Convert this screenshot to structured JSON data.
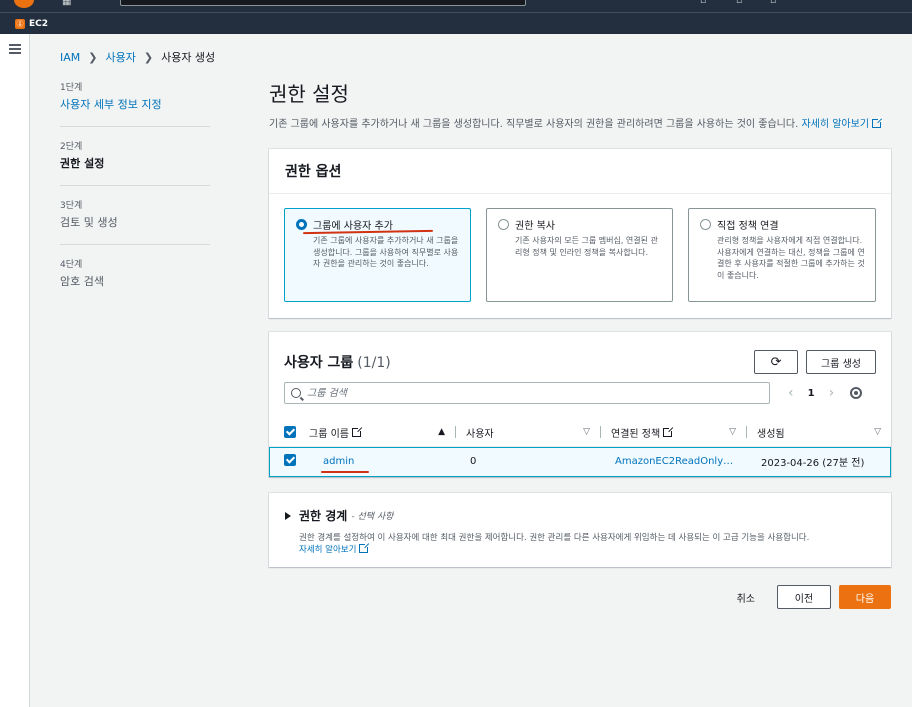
{
  "topnav": {
    "service_badge": "ⓖ",
    "service": "EC2"
  },
  "breadcrumb": {
    "items": [
      "IAM",
      "사용자",
      "사용자 생성"
    ]
  },
  "steps": [
    {
      "num": "1단계",
      "title": "사용자 세부 정보 지정"
    },
    {
      "num": "2단계",
      "title": "권한 설정"
    },
    {
      "num": "3단계",
      "title": "검토 및 생성"
    },
    {
      "num": "4단계",
      "title": "암호 검색"
    }
  ],
  "page": {
    "title": "권한 설정",
    "description": "기존 그룹에 사용자를 추가하거나 새 그룹을 생성합니다. 직무별로 사용자의 권한을 관리하려면 그룹을 사용하는 것이 좋습니다. ",
    "learn_more": "자세히 알아보기"
  },
  "options_panel": {
    "title": "권한 옵션",
    "options": [
      {
        "title": "그룹에 사용자 추가",
        "desc": "기존 그룹에 사용자를 추가하거나 새 그룹을 생성합니다. 그룹을 사용하여 직무별로 사용자 권한을 관리하는 것이 좋습니다.",
        "selected": true
      },
      {
        "title": "권한 복사",
        "desc": "기존 사용자의 모든 그룹 멤버십, 연결된 관리형 정책 및 인라인 정책을 복사합니다.",
        "selected": false
      },
      {
        "title": "직접 정책 연결",
        "desc": "관리형 정책을 사용자에게 직접 연결합니다. 사용자에게 연결하는 대신, 정책을 그룹에 연결한 후 사용자를 적절한 그룹에 추가하는 것이 좋습니다.",
        "selected": false
      }
    ]
  },
  "groups_panel": {
    "title": "사용자 그룹",
    "count": "(1/1)",
    "refresh_icon": "⟳",
    "create_button": "그룹 생성",
    "search_placeholder": "그룹 검색",
    "page": "1",
    "prev": "‹",
    "next": "›",
    "sort_asc_icon": "▲",
    "sort_icon": "▽",
    "columns": [
      "그룹 이름",
      "사용자",
      "연결된 정책",
      "생성됨"
    ],
    "rows": [
      {
        "name": "admin",
        "users": "0",
        "policy": "AmazonEC2ReadOnly…",
        "created": "2023-04-26 (27분 전)"
      }
    ]
  },
  "boundary_panel": {
    "title": "권한 경계",
    "optional": "- 선택 사항",
    "desc": "권한 경계를 설정하여 이 사용자에 대한 최대 권한을 제어합니다. 권한 관리를 다른 사용자에게 위임하는 데 사용되는 이 고급 기능을 사용합니다.",
    "learn_more": "자세히 알아보기"
  },
  "footer": {
    "cancel": "취소",
    "prev": "이전",
    "next": "다음"
  },
  "colors": {
    "accent": "#ec7211",
    "link": "#0073bb",
    "selected_border": "#00a1c9",
    "annotation": "#d13212"
  }
}
